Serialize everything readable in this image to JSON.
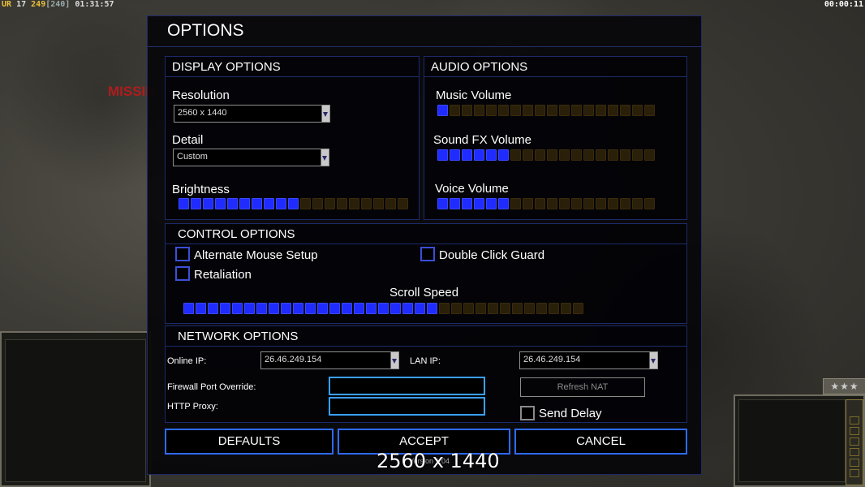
{
  "hud": {
    "left_prefix": "UR",
    "left_level": "17",
    "left_money": "249",
    "left_cap": "[240]",
    "left_time": "01:31:57",
    "right_time": "00:00:11"
  },
  "background": {
    "missing_text": "MISSIN",
    "stars": "★★★"
  },
  "dialog": {
    "title": "OPTIONS",
    "display": {
      "header": "DISPLAY OPTIONS",
      "resolution_label": "Resolution",
      "resolution_value": "2560 x 1440",
      "detail_label": "Detail",
      "detail_value": "Custom",
      "brightness_label": "Brightness",
      "brightness_level": 0.5
    },
    "audio": {
      "header": "AUDIO OPTIONS",
      "music_label": "Music Volume",
      "music_level": 0.06,
      "sfx_label": "Sound FX Volume",
      "sfx_level": 0.33,
      "voice_label": "Voice Volume",
      "voice_level": 0.33
    },
    "control": {
      "header": "CONTROL OPTIONS",
      "alt_mouse_label": "Alternate Mouse Setup",
      "alt_mouse_checked": false,
      "double_click_label": "Double Click Guard",
      "double_click_checked": false,
      "retaliation_label": "Retaliation",
      "retaliation_checked": false,
      "scroll_label": "Scroll Speed",
      "scroll_level": 0.65
    },
    "network": {
      "header": "NETWORK OPTIONS",
      "online_ip_label": "Online IP:",
      "online_ip_value": "26.46.249.154",
      "lan_ip_label": "LAN IP:",
      "lan_ip_value": "26.46.249.154",
      "firewall_label": "Firewall Port Override:",
      "firewall_value": "",
      "proxy_label": "HTTP Proxy:",
      "proxy_value": "",
      "refresh_nat_label": "Refresh NAT",
      "send_delay_label": "Send Delay",
      "send_delay_checked": false
    },
    "buttons": {
      "defaults": "DEFAULTS",
      "accept": "ACCEPT",
      "cancel": "CANCEL"
    },
    "version": "Version 1.04",
    "resolution_overlay": "2560 x 1440"
  }
}
